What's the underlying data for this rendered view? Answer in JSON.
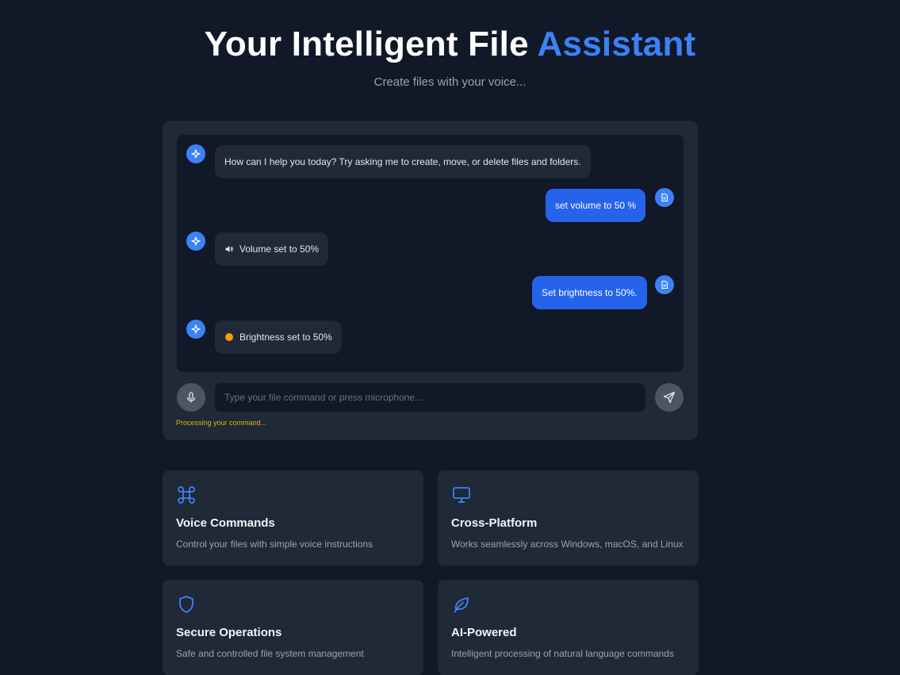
{
  "hero": {
    "title_main": "Your Intelligent File ",
    "title_accent": "Assistant",
    "subtitle": "Create files with your voice..."
  },
  "chat": {
    "messages": [
      {
        "role": "assistant",
        "icon": "sparkle-icon",
        "text": "How can I help you today? Try asking me to create, move, or delete files and folders."
      },
      {
        "role": "user",
        "icon": "document-icon",
        "text": "set volume to 50 %"
      },
      {
        "role": "assistant",
        "icon": "sparkle-icon",
        "inline_icon": "speaker-icon",
        "text": "Volume set to 50%"
      },
      {
        "role": "user",
        "icon": "document-icon",
        "text": "Set brightness to 50%."
      },
      {
        "role": "assistant",
        "icon": "sparkle-icon",
        "inline_icon": "brightness-dot-icon",
        "text": "Brightness set to 50%"
      }
    ],
    "input": {
      "placeholder": "Type your file command or press microphone...",
      "value": ""
    },
    "status": "Processing your command..."
  },
  "features": [
    {
      "icon": "command-key-icon",
      "title": "Voice Commands",
      "description": "Control your files with simple voice instructions"
    },
    {
      "icon": "monitor-icon",
      "title": "Cross-Platform",
      "description": "Works seamlessly across Windows, macOS, and Linux"
    },
    {
      "icon": "shield-icon",
      "title": "Secure Operations",
      "description": "Safe and controlled file system management"
    },
    {
      "icon": "leaf-icon",
      "title": "AI-Powered",
      "description": "Intelligent processing of natural language commands"
    }
  ],
  "colors": {
    "background": "#111827",
    "card": "#1f2937",
    "accent": "#3b82f6",
    "user_bubble": "#2563eb",
    "status": "#eab308"
  }
}
